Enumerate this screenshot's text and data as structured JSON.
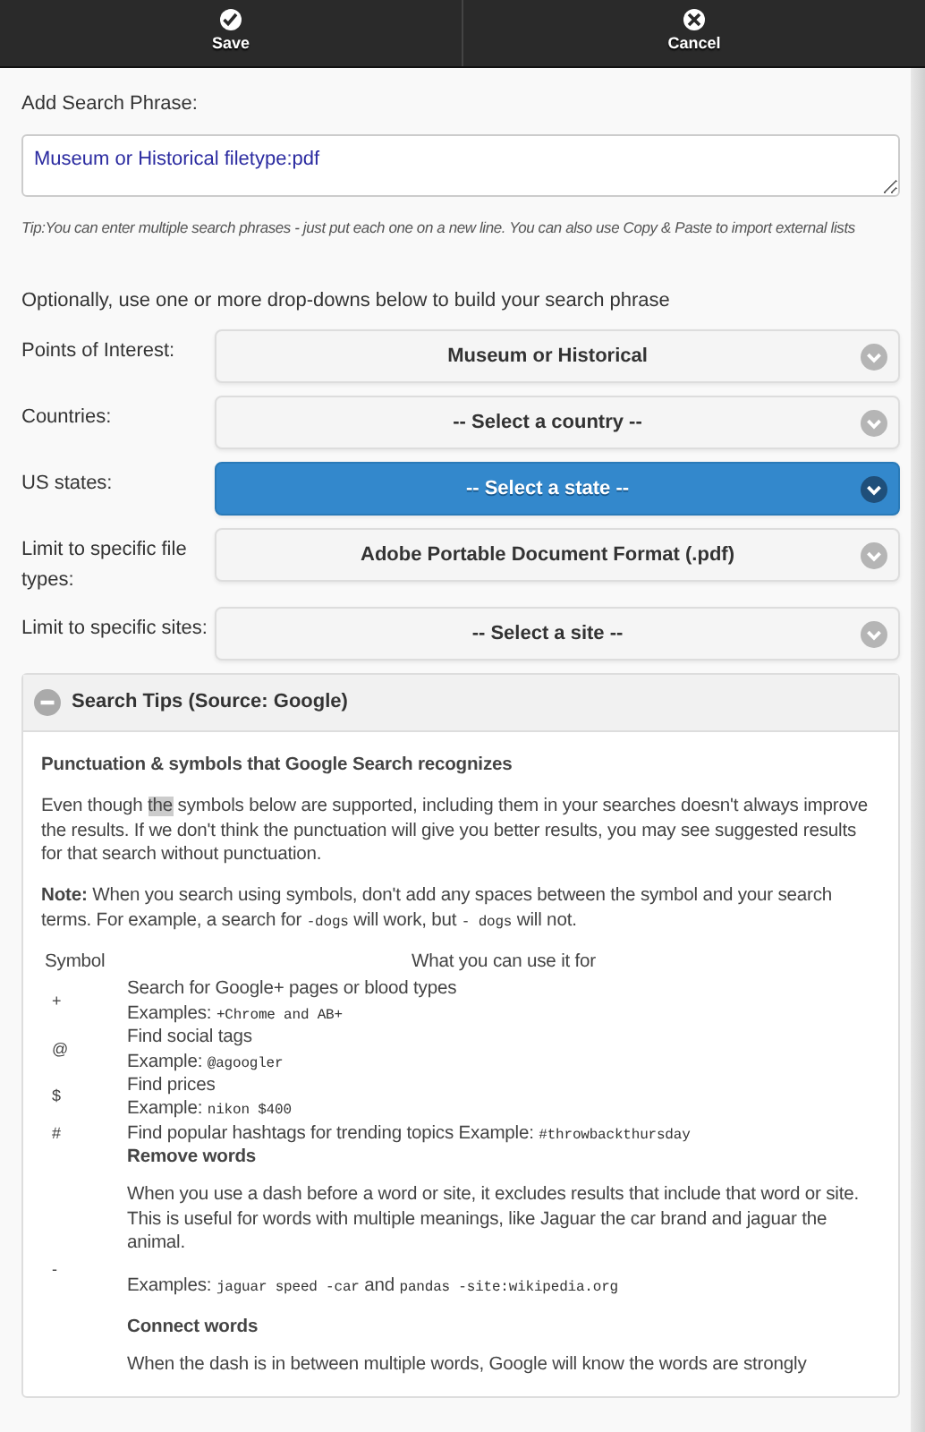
{
  "toolbar": {
    "buttons": [
      {
        "label": "Save",
        "kind": "check"
      },
      {
        "label": "Cancel",
        "kind": "close"
      }
    ]
  },
  "phrase": {
    "label": "Add Search Phrase:",
    "value": "Museum or Historical filetype:pdf",
    "tip": "Tip:You can enter multiple search phrases - just put each one on a new line. You can also use Copy & Paste to import external lists"
  },
  "dropdowns_intro": "Optionally, use one or more drop-downs below to build your search phrase",
  "dropdowns": [
    {
      "label": "Points of Interest:",
      "value": "Museum or Historical",
      "focused": false
    },
    {
      "label": "Countries:",
      "value": "-- Select a country --",
      "focused": false
    },
    {
      "label": "US states:",
      "value": "-- Select a state --",
      "focused": true
    },
    {
      "label": "Limit to specific file types:",
      "value": "Adobe Portable Document Format (.pdf)",
      "focused": false
    },
    {
      "label": "Limit to specific sites:",
      "value": "-- Select a site --",
      "focused": false
    }
  ],
  "search_tips": {
    "title": "Search Tips (Source: Google)",
    "expanded": true,
    "heading": "Punctuation & symbols that Google Search recognizes",
    "paragraphs": [
      [
        {
          "text": "Even though ",
          "kind": "plain"
        },
        {
          "text": "the",
          "kind": "highlight"
        },
        {
          "text": " symbols below are supported, including them in your searches doesn't always improve the results. If we don't think the punctuation will give you better results, you may see suggested results for that search without punctuation.",
          "kind": "plain"
        }
      ],
      [
        {
          "text": "Note:",
          "kind": "bold"
        },
        {
          "text": " When you search using symbols, don't add any spaces between the symbol and your search terms. For example, a search for ",
          "kind": "plain"
        },
        {
          "text": "-dogs",
          "kind": "code"
        },
        {
          "text": " will work, but ",
          "kind": "plain"
        },
        {
          "text": "-  dogs",
          "kind": "code"
        },
        {
          "text": " will not.",
          "kind": "plain"
        }
      ]
    ],
    "columns": [
      "Symbol",
      "What you can use it for"
    ],
    "rows": [
      {
        "symbol": "+",
        "blocks": [
          {
            "kind": "line",
            "parts": [
              {
                "text": "Search for Google+ pages or blood types",
                "kind": "plain"
              }
            ]
          },
          {
            "kind": "line",
            "parts": [
              {
                "text": "Examples: ",
                "kind": "plain"
              },
              {
                "text": "+Chrome and AB+",
                "kind": "code"
              }
            ]
          }
        ]
      },
      {
        "symbol": "@",
        "blocks": [
          {
            "kind": "line",
            "parts": [
              {
                "text": "Find social tags",
                "kind": "plain"
              }
            ]
          },
          {
            "kind": "line",
            "parts": [
              {
                "text": "Example: ",
                "kind": "plain"
              },
              {
                "text": "@agoogler",
                "kind": "code"
              }
            ]
          }
        ]
      },
      {
        "symbol": "$",
        "blocks": [
          {
            "kind": "line",
            "parts": [
              {
                "text": "Find prices",
                "kind": "plain"
              }
            ]
          },
          {
            "kind": "line",
            "parts": [
              {
                "text": "Example: ",
                "kind": "plain"
              },
              {
                "text": "nikon $400",
                "kind": "code"
              }
            ]
          }
        ]
      },
      {
        "symbol": "#",
        "blocks": [
          {
            "kind": "line",
            "parts": [
              {
                "text": "Find popular hashtags for trending topics Example: ",
                "kind": "plain"
              },
              {
                "text": "#throwbackthursday",
                "kind": "code"
              }
            ]
          }
        ]
      },
      {
        "symbol": "-",
        "blocks": [
          {
            "kind": "heading",
            "parts": [
              {
                "text": "Remove words",
                "kind": "plain"
              }
            ]
          },
          {
            "kind": "para",
            "parts": [
              {
                "text": "When you use a dash before a word or site, it excludes results that include that word or site. This is useful for words with multiple meanings, like Jaguar the car brand and jaguar the animal.",
                "kind": "plain"
              }
            ]
          },
          {
            "kind": "para",
            "parts": [
              {
                "text": "Examples: ",
                "kind": "plain"
              },
              {
                "text": "jaguar speed -car",
                "kind": "code"
              },
              {
                "text": " and ",
                "kind": "plain"
              },
              {
                "text": "pandas -site:wikipedia.org",
                "kind": "code"
              }
            ]
          },
          {
            "kind": "heading",
            "parts": [
              {
                "text": "Connect words",
                "kind": "plain"
              }
            ]
          },
          {
            "kind": "para",
            "parts": [
              {
                "text": "When the dash is in between multiple words, Google will know the words are strongly",
                "kind": "plain"
              }
            ]
          }
        ]
      }
    ]
  }
}
